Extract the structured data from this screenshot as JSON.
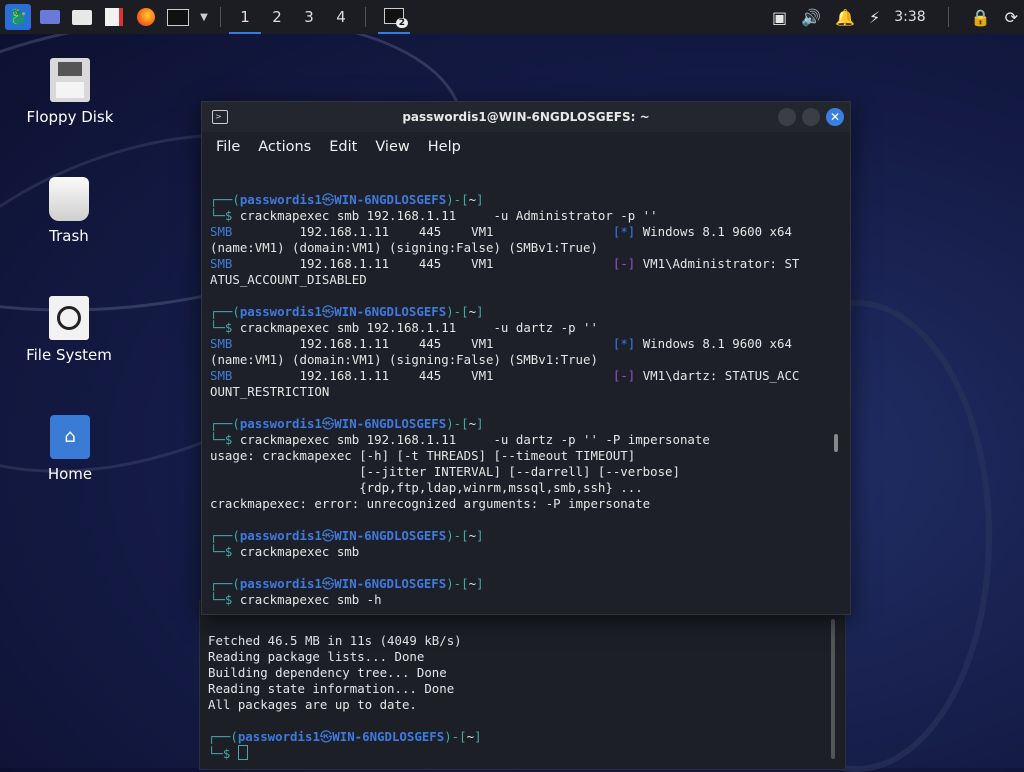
{
  "panel": {
    "workspaces": [
      "1",
      "2",
      "3",
      "4"
    ],
    "task_badge": "2",
    "clock": "3:38"
  },
  "desktop": {
    "icons": [
      "Floppy Disk",
      "Trash",
      "File System",
      "Home"
    ]
  },
  "terminal": {
    "title": "passwordis1@WIN-6NGDLOSGEFS: ~",
    "menu": [
      "File",
      "Actions",
      "Edit",
      "View",
      "Help"
    ],
    "user": "passwordis1",
    "host": "WIN-6NGDLOSGEFS",
    "dir": "~",
    "blocks": [
      {
        "cmd": "crackmapexec smb 192.168.1.11     -u Administrator -p ''",
        "out": [
          {
            "tag": "SMB",
            "ip": "192.168.1.11",
            "port": "445",
            "host": "VM1",
            "mark": "[*]",
            "msg": "Windows 8.1 9600 x64"
          },
          {
            "cont": "(name:VM1) (domain:VM1) (signing:False) (SMBv1:True)"
          },
          {
            "tag": "SMB",
            "ip": "192.168.1.11",
            "port": "445",
            "host": "VM1",
            "mark": "[-]",
            "msg": "VM1\\Administrator: ST"
          },
          {
            "cont": "ATUS_ACCOUNT_DISABLED"
          }
        ]
      },
      {
        "cmd": "crackmapexec smb 192.168.1.11     -u dartz -p ''",
        "out": [
          {
            "tag": "SMB",
            "ip": "192.168.1.11",
            "port": "445",
            "host": "VM1",
            "mark": "[*]",
            "msg": "Windows 8.1 9600 x64"
          },
          {
            "cont": "(name:VM1) (domain:VM1) (signing:False) (SMBv1:True)"
          },
          {
            "tag": "SMB",
            "ip": "192.168.1.11",
            "port": "445",
            "host": "VM1",
            "mark": "[-]",
            "msg": "VM1\\dartz: STATUS_ACC"
          },
          {
            "cont": "OUNT_RESTRICTION"
          }
        ]
      },
      {
        "cmd": "crackmapexec smb 192.168.1.11     -u dartz -p '' -P impersonate",
        "out": [
          {
            "cont": "usage: crackmapexec [-h] [-t THREADS] [--timeout TIMEOUT]"
          },
          {
            "cont": "                    [--jitter INTERVAL] [--darrell] [--verbose]"
          },
          {
            "cont": "                    {rdp,ftp,ldap,winrm,mssql,smb,ssh} ..."
          },
          {
            "cont": "crackmapexec: error: unrecognized arguments: -P impersonate"
          }
        ]
      },
      {
        "cmd": "crackmapexec smb",
        "out": []
      },
      {
        "cmd": "crackmapexec smb -h",
        "out": []
      }
    ]
  },
  "back_terminal": {
    "lines": [
      "Fetched 46.5 MB in 11s (4049 kB/s)",
      "Reading package lists... Done",
      "Building dependency tree... Done",
      "Reading state information... Done",
      "All packages are up to date."
    ]
  }
}
